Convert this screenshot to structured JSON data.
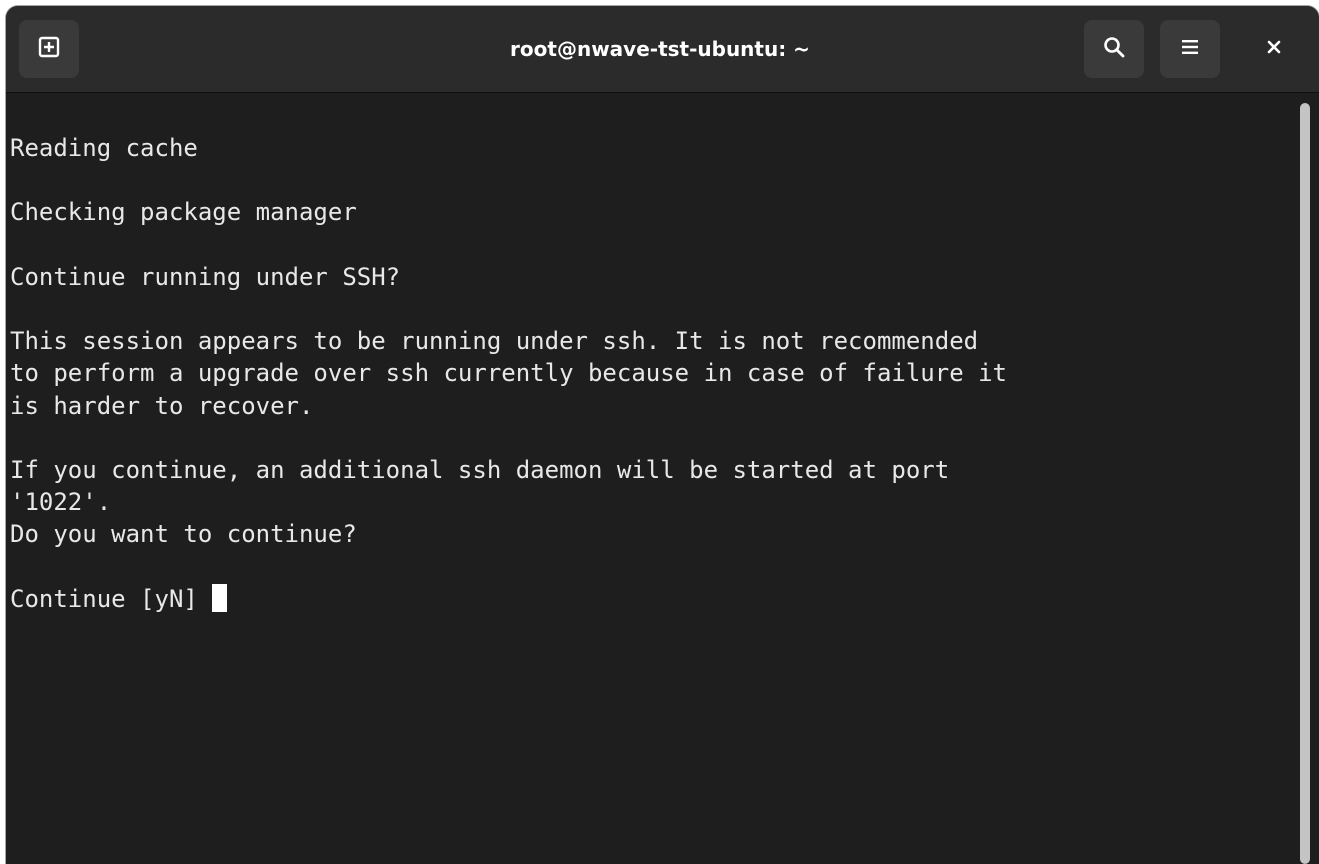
{
  "window": {
    "title": "root@nwave-tst-ubuntu: ~"
  },
  "header": {
    "new_tab_icon": "new-tab-icon",
    "search_icon": "search-icon",
    "menu_icon": "hamburger-menu-icon",
    "close_icon": "close-icon"
  },
  "terminal": {
    "lines": [
      "Reading cache",
      "",
      "Checking package manager",
      "",
      "Continue running under SSH?",
      "",
      "This session appears to be running under ssh. It is not recommended",
      "to perform a upgrade over ssh currently because in case of failure it",
      "is harder to recover.",
      "",
      "If you continue, an additional ssh daemon will be started at port",
      "'1022'.",
      "Do you want to continue?",
      ""
    ],
    "prompt": "Continue [yN] "
  },
  "colors": {
    "background": "#1e1e1e",
    "headerbar": "#2b2b2b",
    "button": "#3a3a3a",
    "text": "#e8e8e8",
    "cursor": "#ffffff"
  }
}
